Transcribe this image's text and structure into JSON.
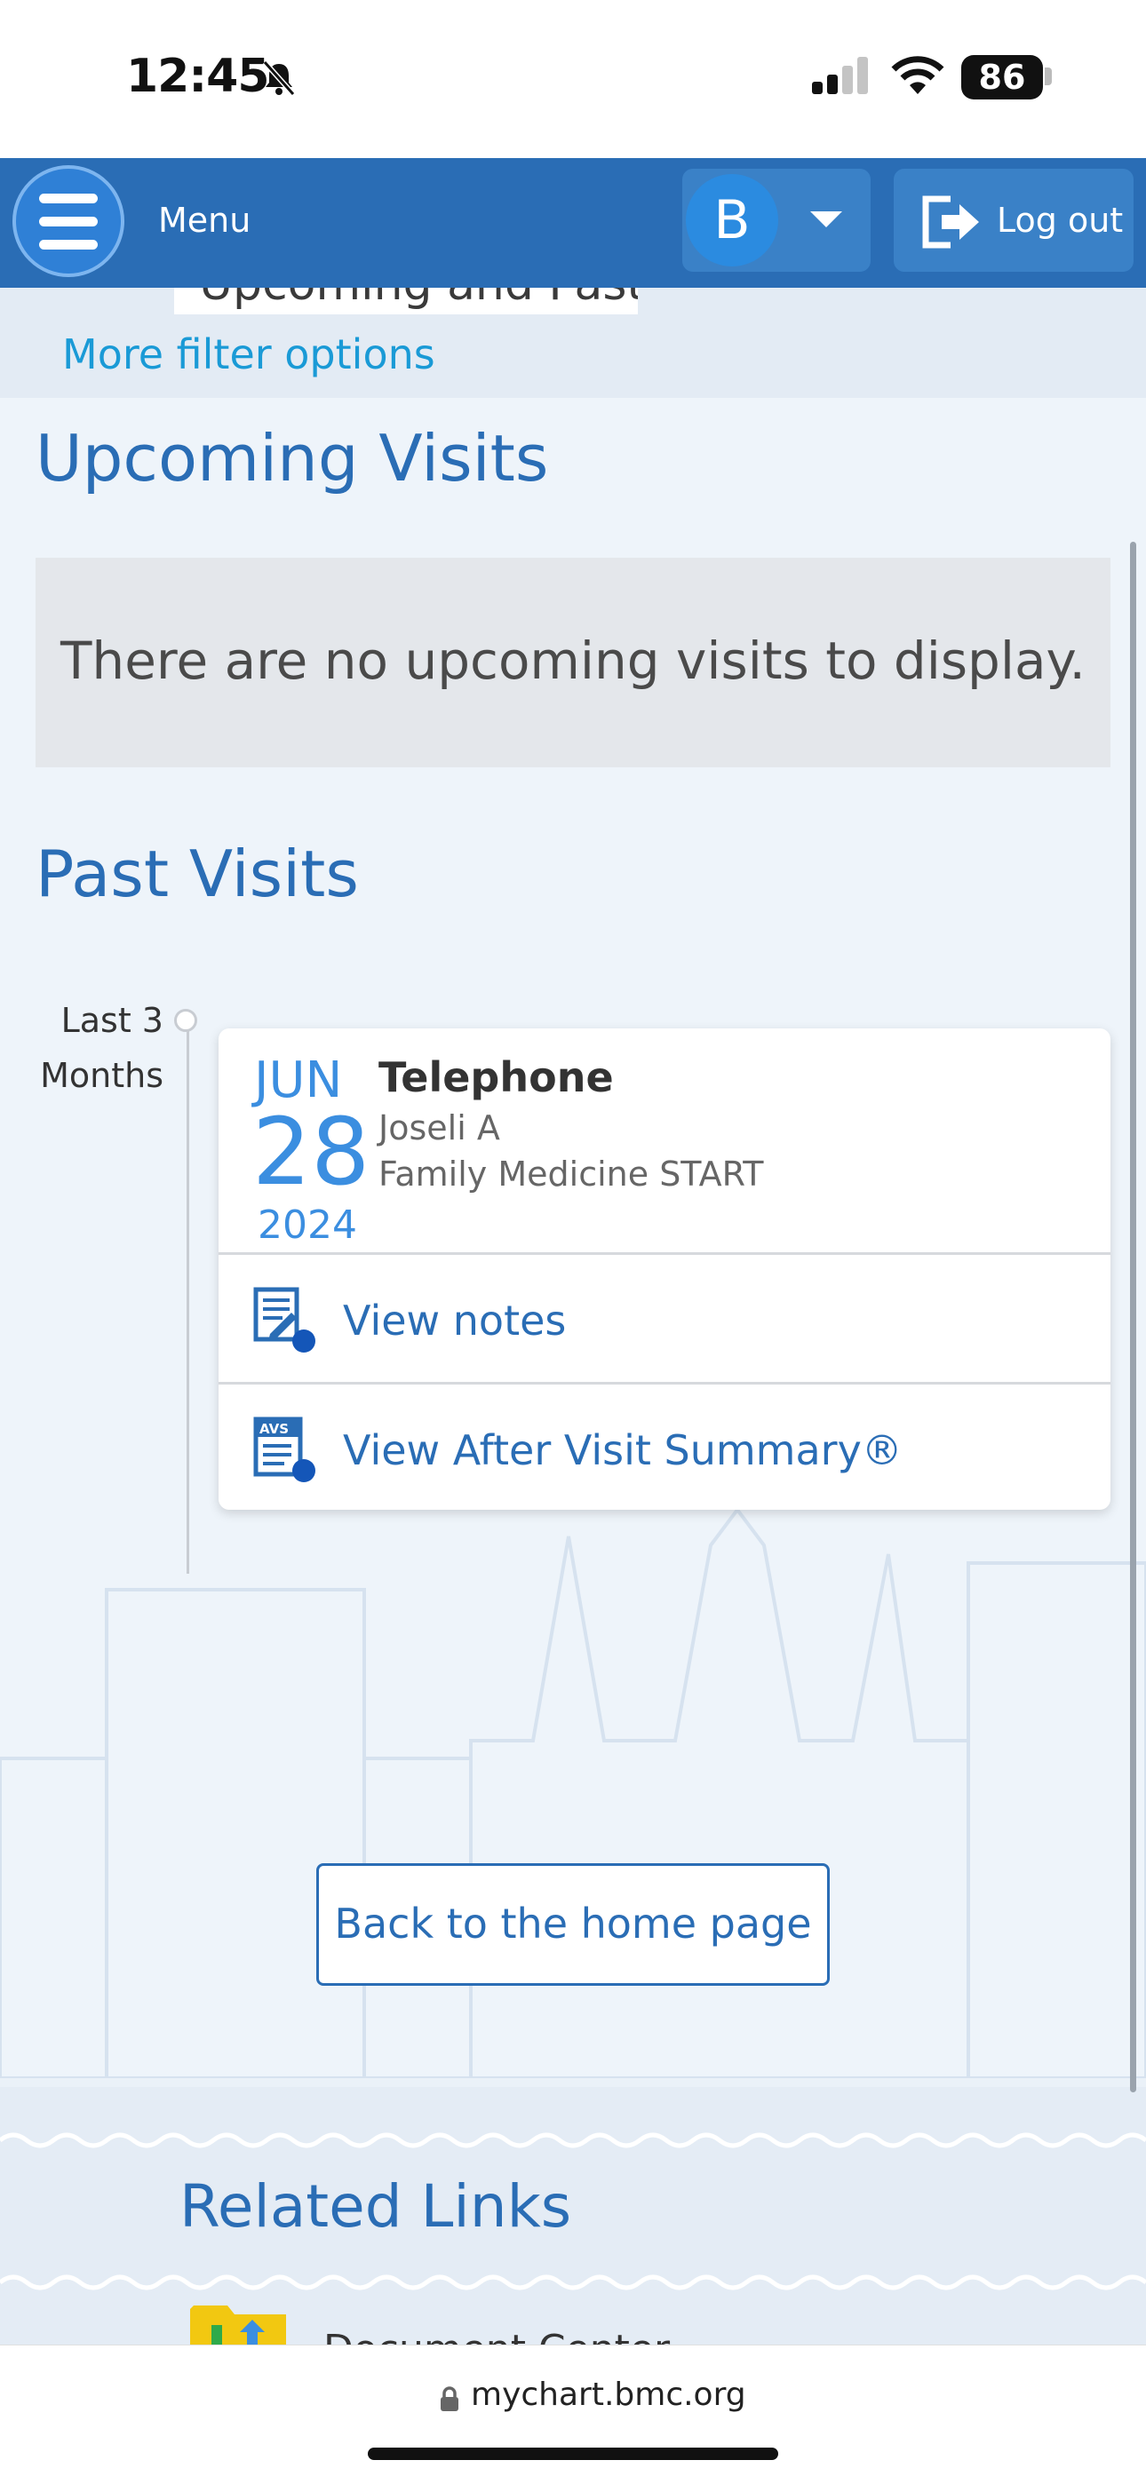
{
  "status_bar": {
    "time": "12:45",
    "battery": "86"
  },
  "header": {
    "menu_label": "Menu",
    "user_initial": "B",
    "logout_label": "Log out"
  },
  "filters": {
    "period": "Upcoming and Past",
    "more_filters": "More filter options"
  },
  "upcoming": {
    "title": "Upcoming Visits",
    "empty_message": "There are no upcoming visits to display."
  },
  "past": {
    "title": "Past Visits",
    "timeline_label": "Last 3 Months",
    "visits": [
      {
        "month": "JUN",
        "day": "28",
        "year": "2024",
        "type": "Telephone",
        "provider": "Joseli A",
        "department": "Family Medicine START",
        "actions": {
          "notes": "View notes",
          "avs": "View After Visit Summary®"
        }
      }
    ]
  },
  "back_button": "Back to the home page",
  "related": {
    "title": "Related Links",
    "items": [
      {
        "label": "Document Center"
      }
    ]
  },
  "browser": {
    "url": "mychart.bmc.org"
  },
  "colors": {
    "brand": "#2a6db5",
    "accent": "#3b8ee0",
    "link": "#1a9ad6"
  }
}
